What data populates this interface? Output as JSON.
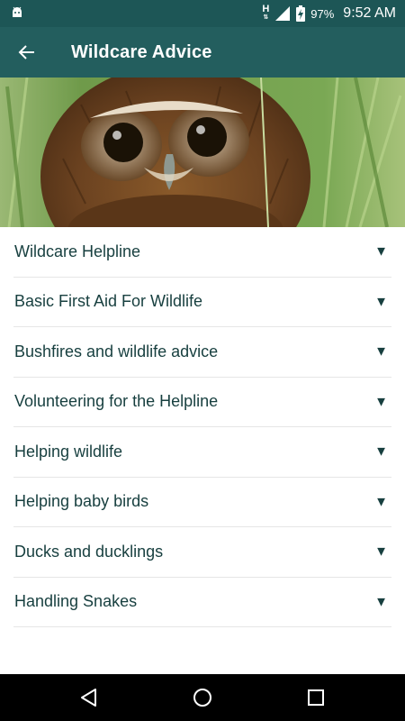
{
  "status_bar": {
    "network_type": "H",
    "battery_percent": "97%",
    "time": "9:52 AM",
    "icons": [
      "android-icon",
      "network-h-icon",
      "signal-icon",
      "battery-charging-icon"
    ]
  },
  "app_bar": {
    "title": "Wildcare Advice",
    "back_icon": "back-arrow-icon",
    "background": "#235e5e"
  },
  "hero": {
    "subject": "owl-photo"
  },
  "list": {
    "items": [
      {
        "label": "Wildcare Helpline",
        "icon": "caret-down-icon"
      },
      {
        "label": "Basic First Aid For Wildlife",
        "icon": "caret-down-icon"
      },
      {
        "label": "Bushfires and wildlife advice",
        "icon": "caret-down-icon"
      },
      {
        "label": "Volunteering for the Helpline",
        "icon": "caret-down-icon"
      },
      {
        "label": "Helping wildlife",
        "icon": "caret-down-icon"
      },
      {
        "label": "Helping baby birds",
        "icon": "caret-down-icon"
      },
      {
        "label": "Ducks and ducklings",
        "icon": "caret-down-icon"
      },
      {
        "label": "Handling Snakes",
        "icon": "caret-down-icon"
      }
    ],
    "caret_glyph": "▼"
  },
  "nav_bar": {
    "buttons": [
      "nav-back-icon",
      "nav-home-icon",
      "nav-recents-icon"
    ]
  },
  "colors": {
    "status_bar": "#1d5656",
    "app_bar": "#235e5e",
    "list_text": "#173f3f",
    "divider": "#e6e6e6"
  }
}
